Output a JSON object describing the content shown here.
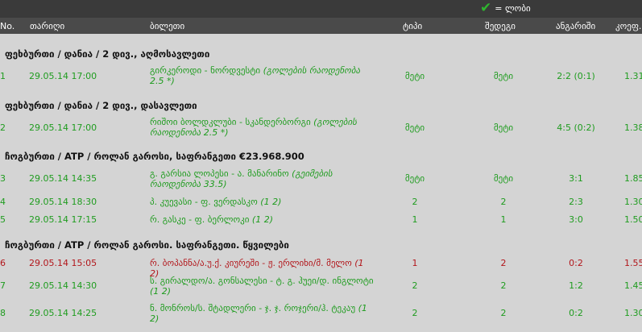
{
  "legend": {
    "label": "= ლობი",
    "icon": "check-icon",
    "color": "#2fb52f"
  },
  "columns": {
    "no": "No.",
    "date": "თარიღი",
    "ticket": "ბილეთი",
    "type": "ტიპი",
    "result": "შედეგი",
    "score": "ანგარიში",
    "coef": "კოეფ."
  },
  "groups": [
    {
      "title": "ფეხბურთი / დანია / 2 დივ., აღმოსავლეთი",
      "rows": [
        {
          "no": "1",
          "date": "29.05.14 17:00",
          "ticket": "გირკეროდი - ნორდვესტი",
          "ticket_note": "(გოლების რაოდენობა 2.5 *)",
          "type": "მეტი",
          "result": "მეტი",
          "score": "2:2 (0:1)",
          "coef": "1.31",
          "status": "won"
        }
      ]
    },
    {
      "title": "ფეხბურთი / დანია / 2 დივ., დასავლეთი",
      "rows": [
        {
          "no": "2",
          "date": "29.05.14 17:00",
          "ticket": "რიშოი ბოლდკლუბი - სკანდერბორგი",
          "ticket_note": "(გოლების რაოდენობა 2.5 *)",
          "type": "მეტი",
          "result": "მეტი",
          "score": "4:5 (0:2)",
          "coef": "1.38",
          "status": "won"
        }
      ]
    },
    {
      "title": "ჩოგბურთი / ATP / როლან გაროსი, საფრანგეთი €23.968.900",
      "rows": [
        {
          "no": "3",
          "date": "29.05.14 14:35",
          "ticket": "გ. გარსია ლოპესი - ა. მანარინო",
          "ticket_note": "(გეიმების რაოდენობა 33.5)",
          "type": "მეტი",
          "result": "მეტი",
          "score": "3:1",
          "coef": "1.85",
          "status": "won"
        },
        {
          "no": "4",
          "date": "29.05.14 18:30",
          "ticket": "პ. კუევასი - ფ. ვერდასკო",
          "ticket_note": "(1 2)",
          "type": "2",
          "result": "2",
          "score": "2:3",
          "coef": "1.30",
          "status": "won"
        },
        {
          "no": "5",
          "date": "29.05.14 17:15",
          "ticket": "რ. გასკე - ფ. ბერლოკი",
          "ticket_note": "(1 2)",
          "type": "1",
          "result": "1",
          "score": "3:0",
          "coef": "1.50",
          "status": "won"
        }
      ]
    },
    {
      "title": "ჩოგბურთი / ATP / როლან გაროსი. საფრანგეთი. წყვილები",
      "rows": [
        {
          "no": "6",
          "date": "29.05.14 15:05",
          "ticket": "რ. ბოპანნა/ა.უ.ქ. კიურეში - ჟ. ერლიხი/მ. მელო",
          "ticket_note": "(1 2)",
          "type": "1",
          "result": "2",
          "score": "0:2",
          "coef": "1.55",
          "status": "lost"
        },
        {
          "no": "7",
          "date": "29.05.14 14:30",
          "ticket": "ს. გირალდო/ა. გონსალესი - ტ. გ. ჰუეი/დ. ინგლოტი",
          "ticket_note": "(1 2)",
          "type": "2",
          "result": "2",
          "score": "1:2",
          "coef": "1.45",
          "status": "won"
        },
        {
          "no": "8",
          "date": "29.05.14 14:25",
          "ticket": "ნ. მონროს/ს. შტადლერი - ჯ. ჯ. როჯერი/ჰ. ტეკაუ",
          "ticket_note": "(1 2)",
          "type": "2",
          "result": "2",
          "score": "0:2",
          "coef": "1.30",
          "status": "won"
        }
      ]
    }
  ]
}
